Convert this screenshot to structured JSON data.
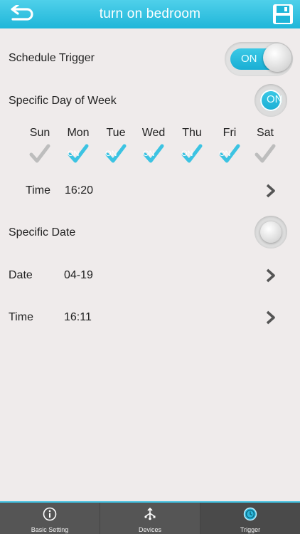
{
  "header": {
    "title": "turn on bedroom",
    "back_icon": "back-arrow-icon",
    "save_icon": "save-icon"
  },
  "schedule_trigger": {
    "label": "Schedule Trigger",
    "toggle_text": "ON"
  },
  "specific_day_of_week": {
    "label": "Specific Day of Week",
    "toggle_text": "ON"
  },
  "days": [
    {
      "name": "Sun",
      "checked": false
    },
    {
      "name": "Mon",
      "checked": true
    },
    {
      "name": "Tue",
      "checked": true
    },
    {
      "name": "Wed",
      "checked": true
    },
    {
      "name": "Thu",
      "checked": true
    },
    {
      "name": "Fri",
      "checked": true
    },
    {
      "name": "Sat",
      "checked": false
    }
  ],
  "day_check_text": "ON",
  "week_time": {
    "label": "Time",
    "value": "16:20"
  },
  "specific_date": {
    "label": "Specific Date"
  },
  "date": {
    "label": "Date",
    "value": "04-19"
  },
  "date_time": {
    "label": "Time",
    "value": "16:11"
  },
  "tabs": [
    {
      "label": "Basic Setting",
      "icon": "info-icon"
    },
    {
      "label": "Devices",
      "icon": "devices-icon"
    },
    {
      "label": "Trigger",
      "icon": "clock-icon"
    }
  ],
  "colors": {
    "accent": "#1fb6d9",
    "check_on": "#3cc3e2",
    "check_off": "#bdbdbd",
    "tabbar": "#555555"
  }
}
